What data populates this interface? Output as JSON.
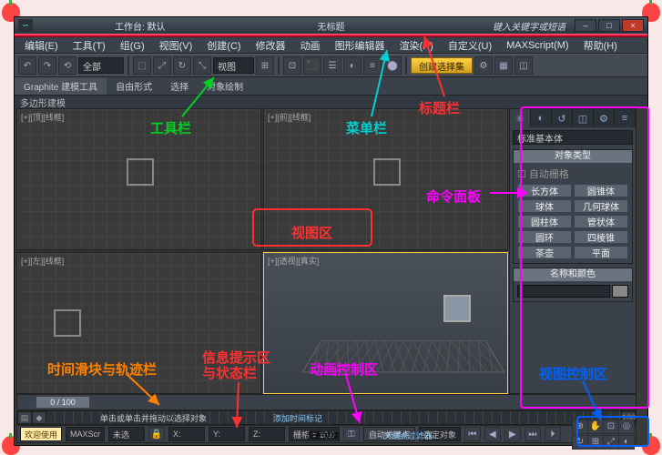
{
  "decorations": {
    "apples_visible": true
  },
  "titlebar": {
    "logo_char": "∽",
    "workspace": "工作台: 默认",
    "title": "无标题",
    "keyword_hint": "键入关键字或短语",
    "min": "–",
    "max": "□",
    "close": "×"
  },
  "menubar": [
    "编辑(E)",
    "工具(T)",
    "组(G)",
    "视图(V)",
    "创建(C)",
    "修改器",
    "动画",
    "图形编辑器",
    "渲染(R)",
    "自定义(U)",
    "MAXScript(M)",
    "帮助(H)"
  ],
  "toolbar": {
    "dd_all": "全部",
    "view_dd": "视图",
    "create_btn": "创建选择集",
    "icons": [
      "↶",
      "↷",
      "⟲",
      "⬚",
      "⤢",
      "↔",
      "↻",
      "⤡",
      "⊞",
      "⊡",
      "⬛",
      "☰",
      "◐",
      "≡",
      "⬤",
      "⚙",
      "▦",
      "◫",
      "◧"
    ]
  },
  "ribbon": {
    "t1": "Graphite 建模工具",
    "t2": "自由形式",
    "t3": "选择",
    "t4": "对象绘制"
  },
  "subbar": "多边形建模",
  "viewports": {
    "tl": "[+][顶][线框]",
    "tr": "[+][前][线框]",
    "bl": "[+][左][线框]",
    "br": "[+][透视][真实]"
  },
  "cmdpanel": {
    "tab_icons": [
      "✳",
      "◐",
      "↺",
      "◫",
      "⚙",
      "≡"
    ],
    "dd": "标准基本体",
    "roll1_title": "对象类型",
    "autogrid": "自动栅格",
    "primitives": [
      "长方体",
      "圆锥体",
      "球体",
      "几何球体",
      "圆柱体",
      "管状体",
      "圆环",
      "四棱锥",
      "茶壶",
      "平面"
    ],
    "roll2_title": "名称和颜色"
  },
  "time": {
    "knob": "0 / 100"
  },
  "status": {
    "welcome": "欢迎使用",
    "script": "MAXScr",
    "hint": "单击或单击并拖动以选择对象",
    "none": "未选",
    "x": "X:",
    "y": "Y:",
    "z": "Z:",
    "grid": "栅格 = 10.0",
    "autokey": "自动关键点",
    "seltgt": "选定对象",
    "setkey": "设置关键",
    "keyfilter": "关键点过滤器...",
    "addtag": "添加时间标记",
    "end": "100",
    "play_icons": [
      "⏮",
      "◀",
      "▶",
      "⏭",
      "⏵"
    ],
    "nav_icons": [
      "⊕",
      "✋",
      "⊡",
      "◎",
      "↻",
      "⊞",
      "⤢",
      "◐"
    ]
  },
  "annotations": {
    "toolbar": "工具栏",
    "menubar": "菜单栏",
    "titlebar": "标题栏",
    "viewport": "视图区",
    "cmdpanel": "命令面板",
    "timeslider": "时间滑块与轨迹栏",
    "info": "信息提示区\n与状态栏",
    "anim": "动画控制区",
    "navctrl": "视图控制区"
  }
}
